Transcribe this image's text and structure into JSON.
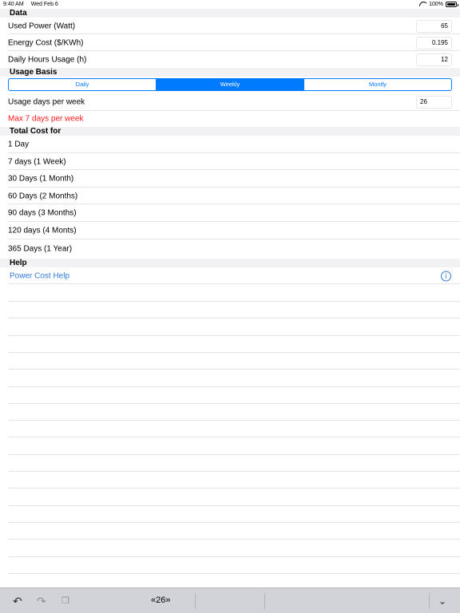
{
  "status": {
    "time": "9:40 AM",
    "date": "Wed Feb 6",
    "battery": "100%"
  },
  "sections": {
    "data": "Data",
    "usage_basis": "Usage Basis",
    "total_cost": "Total Cost for",
    "help": "Help"
  },
  "fields": {
    "used_power": {
      "label": "Used Power (Watt)",
      "value": "65"
    },
    "energy_cost": {
      "label": "Energy Cost ($/KWh)",
      "value": "0.195"
    },
    "daily_hours": {
      "label": "Daily Hours Usage (h)",
      "value": "12"
    },
    "usage_days": {
      "label": "Usage days per week",
      "value": "26"
    }
  },
  "segments": {
    "daily": "Daily",
    "weekly": "Weekly",
    "monthly": "Montly",
    "selected": "Weekly"
  },
  "warning": "Max 7 days per week",
  "costs": [
    "1 Day",
    "7 days (1 Week)",
    "30 Days (1 Month)",
    "60 Days (2 Months)",
    "90 days (3 Months)",
    "120 days (4 Monts)",
    "365 Days (1 Year)"
  ],
  "help": {
    "link": "Power Cost Help",
    "icon": "info-icon"
  },
  "toolbar": {
    "suggestion": "«26»",
    "icons": [
      "undo-icon",
      "redo-icon",
      "paste-icon",
      "hide-keyboard-icon"
    ]
  },
  "colors": {
    "accent": "#007aff",
    "warning": "#ff1a1a",
    "link": "#2f7bd9",
    "toolbar": "#d1d3d9"
  }
}
